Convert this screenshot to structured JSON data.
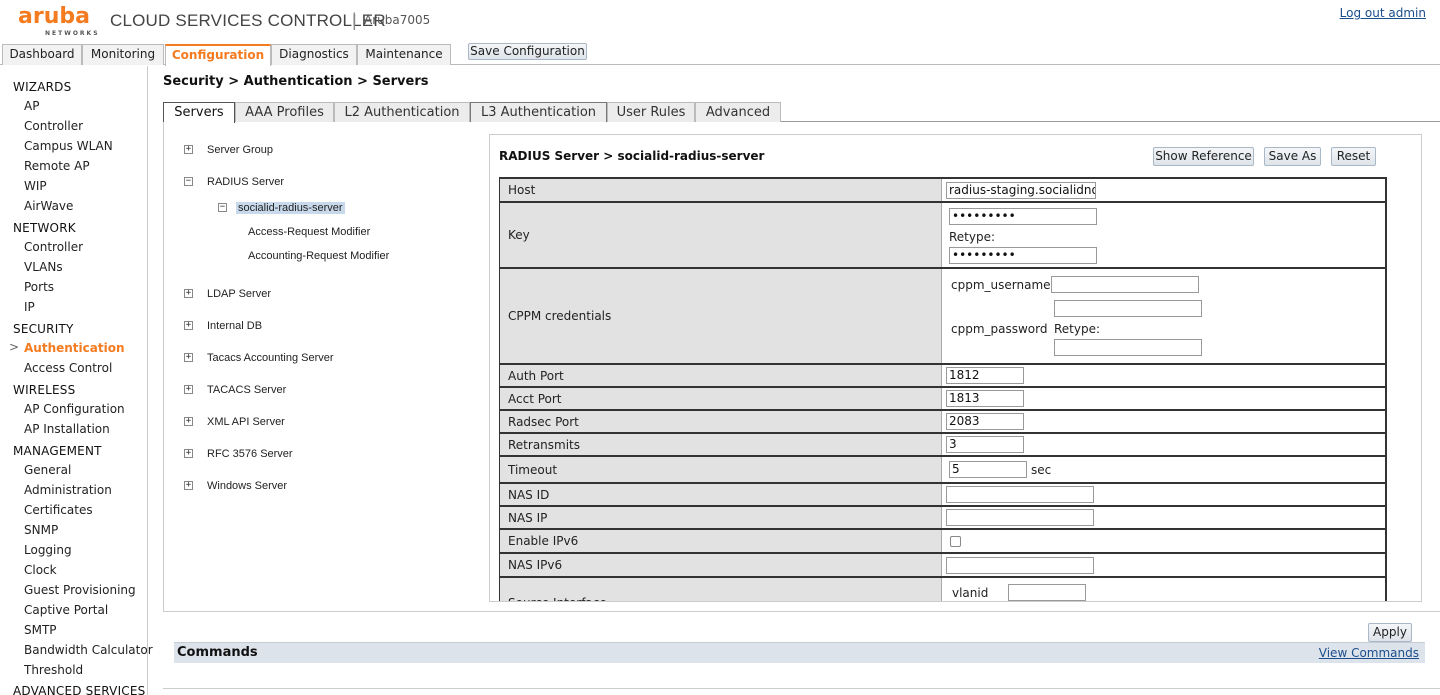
{
  "header": {
    "logo_text": "aruba",
    "logo_sub": "NETWORKS",
    "title": "CLOUD SERVICES CONTROLLER",
    "separator": "|",
    "device": "Aruba7005",
    "logout": "Log out admin"
  },
  "main_tabs": [
    "Dashboard",
    "Monitoring",
    "Configuration",
    "Diagnostics",
    "Maintenance"
  ],
  "active_main_tab": "Configuration",
  "save_configuration": "Save Configuration",
  "sidebar": {
    "sections": [
      {
        "title": "WIZARDS",
        "items": [
          "AP",
          "Controller",
          "Campus WLAN",
          "Remote AP",
          "WIP",
          "AirWave"
        ]
      },
      {
        "title": "NETWORK",
        "items": [
          "Controller",
          "VLANs",
          "Ports",
          "IP"
        ]
      },
      {
        "title": "SECURITY",
        "items": [
          "Authentication",
          "Access Control"
        ]
      },
      {
        "title": "WIRELESS",
        "items": [
          "AP Configuration",
          "AP Installation"
        ]
      },
      {
        "title": "MANAGEMENT",
        "items": [
          "General",
          "Administration",
          "Certificates",
          "SNMP",
          "Logging",
          "Clock",
          "Guest Provisioning",
          "Captive Portal",
          "SMTP",
          "Bandwidth Calculator",
          "Threshold"
        ]
      },
      {
        "title": "ADVANCED SERVICES",
        "items": []
      }
    ],
    "active_item": "Authentication",
    "caret": ">"
  },
  "breadcrumb": "Security > Authentication > Servers",
  "sub_tabs": [
    "Servers",
    "AAA Profiles",
    "L2 Authentication",
    "L3 Authentication",
    "User Rules",
    "Advanced"
  ],
  "active_sub_tab": "Servers",
  "tree": {
    "server_group": "Server Group",
    "radius_server": "RADIUS Server",
    "radius_child": "socialid-radius-server",
    "access_request_modifier": "Access-Request Modifier",
    "accounting_request_modifier": "Accounting-Request Modifier",
    "ldap_server": "LDAP Server",
    "internal_db": "Internal DB",
    "tacacs_accounting": "Tacacs Accounting Server",
    "tacacs_server": "TACACS Server",
    "xml_api": "XML API Server",
    "rfc3576": "RFC 3576 Server",
    "windows_server": "Windows Server",
    "expand_sym": "+",
    "collapse_sym": "−"
  },
  "panel": {
    "title": "RADIUS Server > socialid-radius-server",
    "show_reference": "Show Reference",
    "save_as": "Save As",
    "reset": "Reset"
  },
  "form": {
    "host": {
      "label": "Host",
      "value": "radius-staging.socialidnow"
    },
    "key": {
      "label": "Key",
      "value": "•••••••••",
      "retype_label": "Retype:",
      "retype_value": "•••••••••"
    },
    "cppm": {
      "label": "CPPM credentials",
      "username_label": "cppm_username",
      "username_value": "",
      "password_label": "cppm_password",
      "password_value": "",
      "retype_label": "Retype:",
      "retype_value": ""
    },
    "auth_port": {
      "label": "Auth Port",
      "value": "1812"
    },
    "acct_port": {
      "label": "Acct Port",
      "value": "1813"
    },
    "radsec_port": {
      "label": "Radsec Port",
      "value": "2083"
    },
    "retransmits": {
      "label": "Retransmits",
      "value": "3"
    },
    "timeout": {
      "label": "Timeout",
      "value": "5",
      "unit": "sec"
    },
    "nas_id": {
      "label": "NAS ID",
      "value": ""
    },
    "nas_ip": {
      "label": "NAS IP",
      "value": ""
    },
    "enable_ipv6": {
      "label": "Enable IPv6",
      "checked": false
    },
    "nas_ipv6": {
      "label": "NAS IPv6",
      "value": ""
    },
    "source_interface": {
      "label": "Source Interface",
      "vlanid_label": "vlanid",
      "vlanid_value": ""
    }
  },
  "apply": "Apply",
  "commands": {
    "title": "Commands",
    "view": "View Commands"
  }
}
